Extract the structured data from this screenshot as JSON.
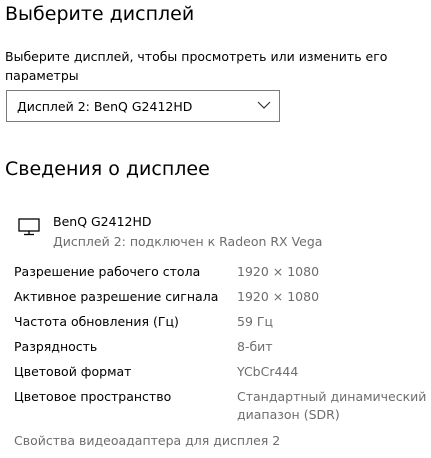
{
  "header": {
    "title": "Выберите дисплей",
    "description": "Выберите дисплей, чтобы просмотреть или изменить его параметры"
  },
  "display_select": {
    "selected": "Дисплей 2: BenQ G2412HD",
    "icon": "chevron-down-icon"
  },
  "info_section": {
    "title": "Сведения о дисплее",
    "monitor": {
      "icon": "monitor-icon",
      "name": "BenQ G2412HD",
      "subtitle": "Дисплей 2: подключен к Radeon RX Vega"
    },
    "properties": [
      {
        "label": "Разрешение рабочего стола",
        "value": "1920 × 1080"
      },
      {
        "label": "Активное разрешение сигнала",
        "value": "1920 × 1080"
      },
      {
        "label": "Частота обновления (Гц)",
        "value": "59 Гц"
      },
      {
        "label": "Разрядность",
        "value": "8-бит"
      },
      {
        "label": "Цветовой формат",
        "value": "YCbCr444"
      },
      {
        "label": "Цветовое пространство",
        "value": "Стандартный динамический диапазон (SDR)"
      }
    ],
    "adapter_link": "Свойства видеоадаптера для дисплея 2"
  },
  "colors": {
    "text": "#000000",
    "secondary_text": "#6d6d6d",
    "border": "#7a7a7a",
    "background": "#ffffff"
  }
}
